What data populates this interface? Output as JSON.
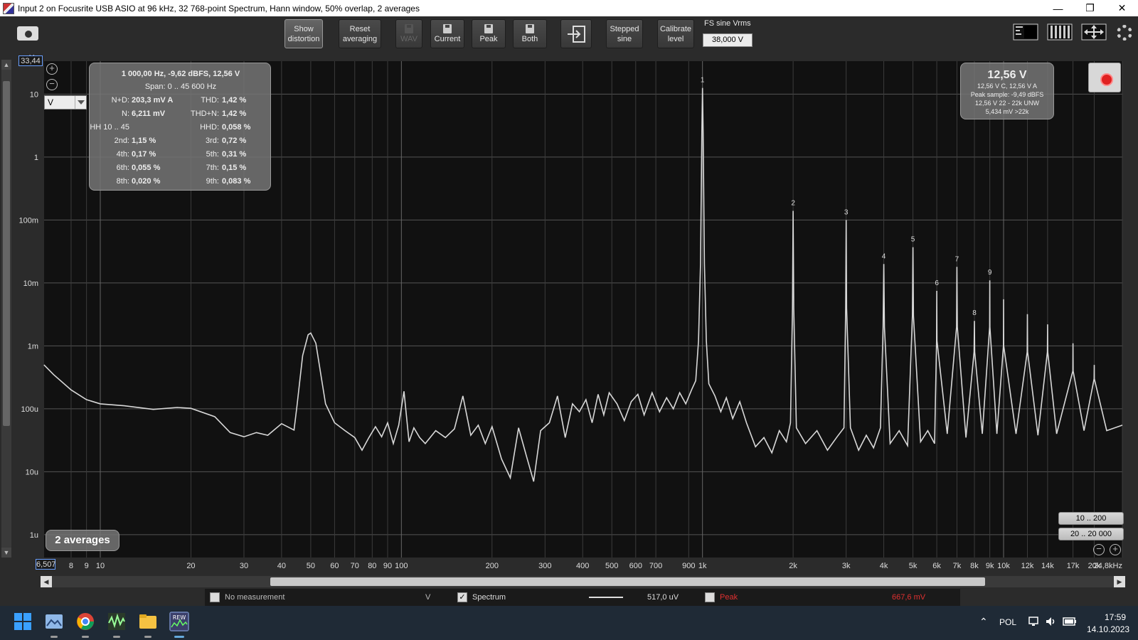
{
  "window": {
    "title": "Input 2 on Focusrite USB ASIO at 96 kHz, 32 768-point Spectrum, Hann window, 50% overlap, 2 averages",
    "controls": [
      "—",
      "❐",
      "✕"
    ]
  },
  "toolbar": {
    "show_distortion": [
      "Show",
      "distortion"
    ],
    "reset_averaging": [
      "Reset",
      "averaging"
    ],
    "wav": "WAV",
    "current": "Current",
    "peak": "Peak",
    "both": "Both",
    "stepped_sine": [
      "Stepped",
      "sine"
    ],
    "calibrate_level": [
      "Calibrate",
      "level"
    ],
    "fs_label": "FS sine Vrms",
    "fs_value": "38,000 V"
  },
  "plot": {
    "unit": "V",
    "unit_top": "V",
    "y_top_value": "33,44",
    "x_left_value": "6,507",
    "y_ticks": [
      {
        "label": "10",
        "v": 10
      },
      {
        "label": "1",
        "v": 1
      },
      {
        "label": "100m",
        "v": 0.1
      },
      {
        "label": "10m",
        "v": 0.01
      },
      {
        "label": "1m",
        "v": 0.001
      },
      {
        "label": "100u",
        "v": 0.0001
      },
      {
        "label": "10u",
        "v": 1e-05
      },
      {
        "label": "1u",
        "v": 1e-06
      }
    ],
    "x_ticks": [
      {
        "label": "8",
        "f": 8
      },
      {
        "label": "9",
        "f": 9
      },
      {
        "label": "10",
        "f": 10
      },
      {
        "label": "20",
        "f": 20
      },
      {
        "label": "30",
        "f": 30
      },
      {
        "label": "40",
        "f": 40
      },
      {
        "label": "50",
        "f": 50
      },
      {
        "label": "60",
        "f": 60
      },
      {
        "label": "70",
        "f": 70
      },
      {
        "label": "80",
        "f": 80
      },
      {
        "label": "90",
        "f": 90
      },
      {
        "label": "100",
        "f": 100
      },
      {
        "label": "200",
        "f": 200
      },
      {
        "label": "300",
        "f": 300
      },
      {
        "label": "400",
        "f": 400
      },
      {
        "label": "500",
        "f": 500
      },
      {
        "label": "600",
        "f": 600
      },
      {
        "label": "700",
        "f": 700
      },
      {
        "label": "900",
        "f": 900
      },
      {
        "label": "1k",
        "f": 1000
      },
      {
        "label": "2k",
        "f": 2000
      },
      {
        "label": "3k",
        "f": 3000
      },
      {
        "label": "4k",
        "f": 4000
      },
      {
        "label": "5k",
        "f": 5000
      },
      {
        "label": "6k",
        "f": 6000
      },
      {
        "label": "7k",
        "f": 7000
      },
      {
        "label": "8k",
        "f": 8000
      },
      {
        "label": "9k",
        "f": 9000
      },
      {
        "label": "10k",
        "f": 10000
      },
      {
        "label": "12k",
        "f": 12000
      },
      {
        "label": "14k",
        "f": 14000
      },
      {
        "label": "17k",
        "f": 17000
      },
      {
        "label": "20k",
        "f": 20000
      },
      {
        "label": "24,8kHz",
        "f": 24800
      }
    ]
  },
  "chart_data": {
    "type": "line",
    "x_scale": "log",
    "y_scale": "log",
    "xlim": [
      6.507,
      24800
    ],
    "ylim": [
      4.34e-07,
      33.44
    ],
    "grid": true,
    "series": [
      {
        "name": "Spectrum",
        "color": "#d8d8d8",
        "points": [
          [
            6.5,
            0.0005
          ],
          [
            7,
            0.00035
          ],
          [
            8,
            0.0002
          ],
          [
            9,
            0.00014
          ],
          [
            10,
            0.00012
          ],
          [
            12,
            0.000112
          ],
          [
            15,
            9.8e-05
          ],
          [
            18,
            0.000105
          ],
          [
            20,
            0.000102
          ],
          [
            24,
            7.5e-05
          ],
          [
            27,
            4.2e-05
          ],
          [
            30,
            3.6e-05
          ],
          [
            33,
            4.2e-05
          ],
          [
            36,
            3.8e-05
          ],
          [
            40,
            5.8e-05
          ],
          [
            44,
            4.6e-05
          ],
          [
            45,
            0.00011
          ],
          [
            47,
            0.0007
          ],
          [
            49,
            0.0015
          ],
          [
            50,
            0.0016
          ],
          [
            52,
            0.0011
          ],
          [
            54,
            0.00035
          ],
          [
            56,
            0.00012
          ],
          [
            60,
            6e-05
          ],
          [
            65,
            4.5e-05
          ],
          [
            70,
            3.5e-05
          ],
          [
            74,
            2.2e-05
          ],
          [
            78,
            3.5e-05
          ],
          [
            82,
            5.2e-05
          ],
          [
            86,
            3.6e-05
          ],
          [
            90,
            6e-05
          ],
          [
            94,
            2.8e-05
          ],
          [
            98,
            5.5e-05
          ],
          [
            102,
            0.00019
          ],
          [
            106,
            3e-05
          ],
          [
            110,
            5e-05
          ],
          [
            115,
            3.5e-05
          ],
          [
            120,
            2.8e-05
          ],
          [
            130,
            4.5e-05
          ],
          [
            140,
            3.5e-05
          ],
          [
            150,
            4.8e-05
          ],
          [
            160,
            0.00016
          ],
          [
            170,
            3.8e-05
          ],
          [
            180,
            5.5e-05
          ],
          [
            190,
            2.8e-05
          ],
          [
            200,
            5.2e-05
          ],
          [
            215,
            1.6e-05
          ],
          [
            230,
            8e-06
          ],
          [
            245,
            5e-05
          ],
          [
            260,
            1.8e-05
          ],
          [
            275,
            7e-06
          ],
          [
            290,
            4.5e-05
          ],
          [
            310,
            6e-05
          ],
          [
            330,
            0.00016
          ],
          [
            350,
            3.5e-05
          ],
          [
            370,
            0.00012
          ],
          [
            390,
            9e-05
          ],
          [
            410,
            0.00014
          ],
          [
            430,
            6e-05
          ],
          [
            450,
            0.00017
          ],
          [
            470,
            8e-05
          ],
          [
            490,
            0.00018
          ],
          [
            520,
            0.00012
          ],
          [
            550,
            6.5e-05
          ],
          [
            580,
            0.00013
          ],
          [
            610,
            0.00017
          ],
          [
            640,
            8e-05
          ],
          [
            680,
            0.00018
          ],
          [
            720,
            9e-05
          ],
          [
            760,
            0.00015
          ],
          [
            800,
            0.0001
          ],
          [
            840,
            0.00018
          ],
          [
            880,
            0.00012
          ],
          [
            920,
            0.0002
          ],
          [
            950,
            0.00028
          ],
          [
            970,
            0.0012
          ],
          [
            985,
            0.02
          ],
          [
            995,
            2.5
          ],
          [
            1000,
            12.56
          ],
          [
            1005,
            2.5
          ],
          [
            1015,
            0.02
          ],
          [
            1030,
            0.0012
          ],
          [
            1050,
            0.00025
          ],
          [
            1100,
            0.00016
          ],
          [
            1150,
            9e-05
          ],
          [
            1200,
            0.00015
          ],
          [
            1260,
            7e-05
          ],
          [
            1330,
            0.00013
          ],
          [
            1400,
            6e-05
          ],
          [
            1500,
            2.5e-05
          ],
          [
            1600,
            3.5e-05
          ],
          [
            1700,
            2e-05
          ],
          [
            1800,
            4.5e-05
          ],
          [
            1900,
            3e-05
          ],
          [
            1960,
            6e-05
          ],
          [
            1990,
            0.004
          ],
          [
            2000,
            0.14
          ],
          [
            2010,
            0.004
          ],
          [
            2050,
            5e-05
          ],
          [
            2200,
            2.8e-05
          ],
          [
            2400,
            4.5e-05
          ],
          [
            2600,
            2.2e-05
          ],
          [
            2800,
            3.6e-05
          ],
          [
            2950,
            5e-05
          ],
          [
            2990,
            0.004
          ],
          [
            3000,
            0.1
          ],
          [
            3010,
            0.004
          ],
          [
            3100,
            5e-05
          ],
          [
            3300,
            2.2e-05
          ],
          [
            3500,
            3.8e-05
          ],
          [
            3700,
            2.4e-05
          ],
          [
            3900,
            5e-05
          ],
          [
            3980,
            0.002
          ],
          [
            4000,
            0.02
          ],
          [
            4020,
            0.002
          ],
          [
            4200,
            2.8e-05
          ],
          [
            4500,
            4.5e-05
          ],
          [
            4800,
            2.6e-05
          ],
          [
            4980,
            0.003
          ],
          [
            5000,
            0.037
          ],
          [
            5020,
            0.003
          ],
          [
            5300,
            3e-05
          ],
          [
            5600,
            4.5e-05
          ],
          [
            5900,
            2.8e-05
          ],
          [
            5990,
            0.0012
          ],
          [
            6000,
            0.0075
          ],
          [
            6010,
            0.0012
          ],
          [
            6500,
            4e-05
          ],
          [
            6980,
            0.002
          ],
          [
            7000,
            0.018
          ],
          [
            7020,
            0.002
          ],
          [
            7500,
            3.5e-05
          ],
          [
            7980,
            0.0008
          ],
          [
            8000,
            0.0025
          ],
          [
            8020,
            0.0008
          ],
          [
            8500,
            4e-05
          ],
          [
            8990,
            0.002
          ],
          [
            9000,
            0.011
          ],
          [
            9010,
            0.002
          ],
          [
            9500,
            4e-05
          ],
          [
            9990,
            0.001
          ],
          [
            10000,
            0.0055
          ],
          [
            10010,
            0.001
          ],
          [
            11000,
            4e-05
          ],
          [
            11980,
            0.0008
          ],
          [
            12000,
            0.0032
          ],
          [
            12020,
            0.0008
          ],
          [
            13000,
            3.8e-05
          ],
          [
            13980,
            0.0008
          ],
          [
            14000,
            0.0022
          ],
          [
            14020,
            0.0008
          ],
          [
            15000,
            4e-05
          ],
          [
            16980,
            0.0004
          ],
          [
            17000,
            0.0011
          ],
          [
            17020,
            0.0004
          ],
          [
            18500,
            4.5e-05
          ],
          [
            19980,
            0.0003
          ],
          [
            20000,
            0.0005
          ],
          [
            20020,
            0.0003
          ],
          [
            22000,
            4.5e-05
          ],
          [
            24800,
            5.5e-05
          ]
        ]
      }
    ],
    "harmonic_markers": [
      {
        "label": "1",
        "f": 1000,
        "v": 12.56
      },
      {
        "label": "2",
        "f": 2000,
        "v": 0.14
      },
      {
        "label": "3",
        "f": 3000,
        "v": 0.1
      },
      {
        "label": "4",
        "f": 4000,
        "v": 0.02
      },
      {
        "label": "5",
        "f": 5000,
        "v": 0.037
      },
      {
        "label": "6",
        "f": 6000,
        "v": 0.0075
      },
      {
        "label": "7",
        "f": 7000,
        "v": 0.018
      },
      {
        "label": "8",
        "f": 8000,
        "v": 0.0025
      },
      {
        "label": "9",
        "f": 9000,
        "v": 0.011
      }
    ]
  },
  "distortion_panel": {
    "header": "1 000,00 Hz, -9,62 dBFS, 12,56 V",
    "span": "Span: 0 .. 45 600 Hz",
    "rows": [
      {
        "l1": "N+D:",
        "v1": "203,3 mV A",
        "l2": "THD:",
        "v2": "1,42 %"
      },
      {
        "l1": "N:",
        "v1": "6,211 mV",
        "l2": "THD+N:",
        "v2": "1,42 %"
      },
      {
        "l1": "HH 10 .. 45",
        "v1": "",
        "l2": "HHD:",
        "v2": "0,058 %"
      },
      {
        "l1": "2nd:",
        "v1": "1,15 %",
        "l2": "3rd:",
        "v2": "0,72 %"
      },
      {
        "l1": "4th:",
        "v1": "0,17 %",
        "l2": "5th:",
        "v2": "0,31 %"
      },
      {
        "l1": "6th:",
        "v1": "0,055 %",
        "l2": "7th:",
        "v2": "0,15 %"
      },
      {
        "l1": "8th:",
        "v1": "0,020 %",
        "l2": "9th:",
        "v2": "0,083 %"
      }
    ]
  },
  "level_panel": {
    "value": "12,56 V",
    "lines": [
      "12,56 V C, 12,56 V A",
      "Peak sample: -9,49 dBFS",
      "12,56 V 22 - 22k UNW",
      "5,434 mV >22k"
    ]
  },
  "averages_badge": "2 averages",
  "range_buttons": [
    "10 .. 200",
    "20 .. 20 000"
  ],
  "zoom": {
    "plus": "+",
    "minus": "−"
  },
  "legend": {
    "no_measurement": "No measurement",
    "unit": "V",
    "spectrum": "Spectrum",
    "spectrum_value": "517,0 uV",
    "peak": "Peak",
    "peak_value": "667,6 mV",
    "peak_color": "#e03030"
  },
  "taskbar": {
    "language": "POL",
    "time": "17:59",
    "date": "14.10.2023"
  }
}
